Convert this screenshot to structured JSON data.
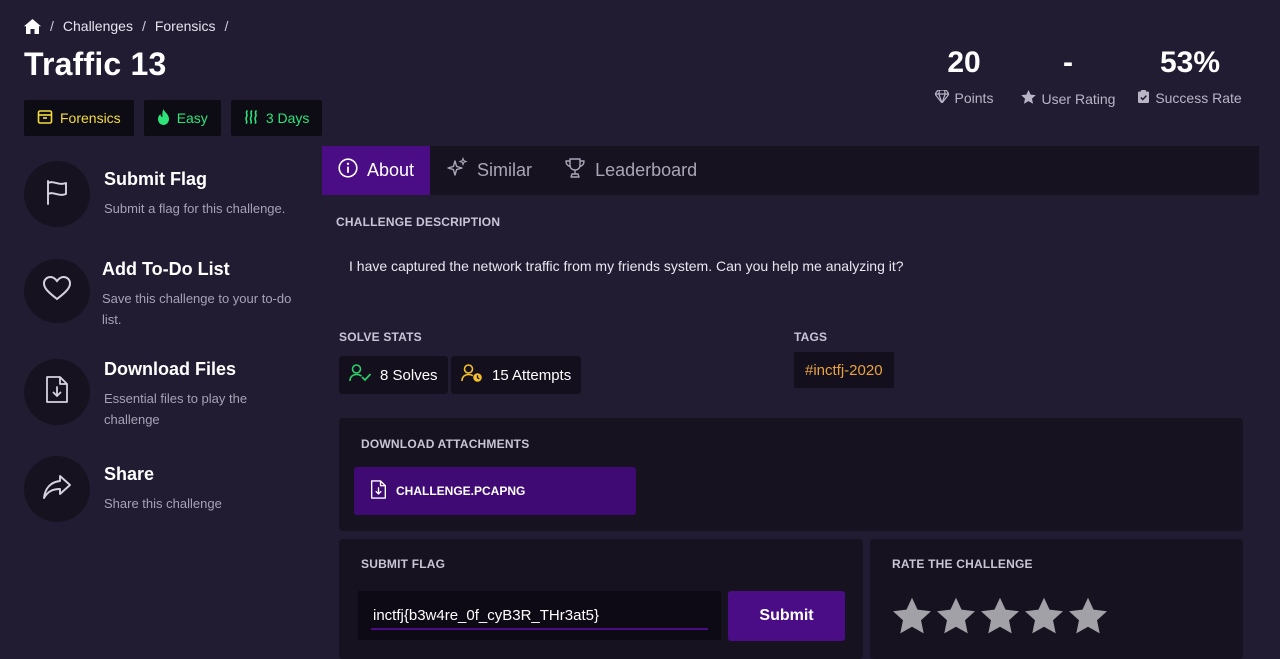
{
  "breadcrumb": {
    "items": [
      "Challenges",
      "Forensics"
    ],
    "sep": "/"
  },
  "challenge": {
    "title": "Traffic 13",
    "category": "Forensics",
    "difficulty": "Easy",
    "age": "3 Days",
    "category_color": "#f5dc3c",
    "difficulty_color": "#2ee37a"
  },
  "stats": {
    "points": {
      "value": "20",
      "label": "Points",
      "icon": "diamond-icon"
    },
    "rating": {
      "value": "-",
      "label": "User Rating",
      "icon": "star-icon"
    },
    "success": {
      "value": "53%",
      "label": "Success Rate",
      "icon": "clipboard-check-icon"
    }
  },
  "actions": [
    {
      "title": "Submit Flag",
      "subtitle": "Submit a flag for this challenge.",
      "icon": "flag-icon"
    },
    {
      "title": "Add To-Do List",
      "subtitle": "Save this challenge to your to-do list.",
      "icon": "heart-icon"
    },
    {
      "title": "Download Files",
      "subtitle": "Essential files to play the challenge",
      "icon": "file-download-icon"
    },
    {
      "title": "Share",
      "subtitle": "Share this challenge",
      "icon": "share-icon"
    }
  ],
  "tabs": [
    {
      "label": "About",
      "active": true
    },
    {
      "label": "Similar",
      "active": false
    },
    {
      "label": "Leaderboard",
      "active": false
    }
  ],
  "about": {
    "description_label": "CHALLENGE DESCRIPTION",
    "description": "I have captured the network traffic from my friends system. Can you help me analyzing it?",
    "solve_stats_label": "SOLVE STATS",
    "solves": "8 Solves",
    "attempts": "15 Attempts",
    "tags_label": "TAGS",
    "tags": [
      "#inctfj-2020"
    ]
  },
  "download": {
    "label": "DOWNLOAD ATTACHMENTS",
    "file": "CHALLENGE.PCAPNG"
  },
  "submit": {
    "label": "SUBMIT FLAG",
    "value": "inctfj{b3w4re_0f_cyB3R_THr3at5}",
    "button": "Submit"
  },
  "rate": {
    "label": "RATE THE CHALLENGE",
    "stars_total": 5,
    "stars_filled": 0
  },
  "colors": {
    "accent": "#4a0d85",
    "background": "#221c33",
    "panel": "#17121f",
    "tag": "#e8a341"
  }
}
